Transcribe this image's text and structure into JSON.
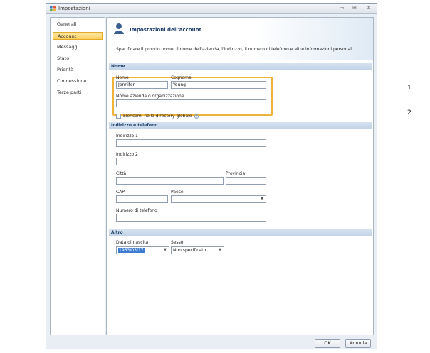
{
  "window": {
    "title": "Impostazioni",
    "controls": {
      "minimize": "▭",
      "maximize": "⊞",
      "close": "✕"
    }
  },
  "sidebar": {
    "items": [
      {
        "label": "Generali"
      },
      {
        "label": "Account"
      },
      {
        "label": "Messaggi"
      },
      {
        "label": "Stato"
      },
      {
        "label": "Priorità"
      },
      {
        "label": "Connessione"
      },
      {
        "label": "Terze parti"
      }
    ],
    "selected": "Account"
  },
  "header": {
    "title": "Impostazioni dell'account",
    "description": "Specificare il proprio nome, il nome dell'azienda, l'indirizzo, il numero di telefono e altre informazioni personali."
  },
  "sections": {
    "nome": {
      "title": "Nome",
      "first_name_label": "Nome",
      "first_name_value": "Jennifer",
      "last_name_label": "Cognome",
      "last_name_value": "Young",
      "company_label": "Nome azienda o organizzazione",
      "company_value": "",
      "directory_checkbox_label": "Elencami nella directory globale",
      "info_icon": "i"
    },
    "address": {
      "title": "Indirizzo e telefono",
      "address1_label": "Indirizzo 1",
      "address1_value": "",
      "address2_label": "Indirizzo 2",
      "address2_value": "",
      "city_label": "Città",
      "city_value": "",
      "province_label": "Provincia",
      "province_value": "",
      "cap_label": "CAP",
      "cap_value": "",
      "country_label": "Paese",
      "country_value": "",
      "phone_label": "Numero di telefono",
      "phone_value": ""
    },
    "altro": {
      "title": "Altro",
      "birth_label": "Data di nascita",
      "birth_value": "1963/03/17",
      "sex_label": "Sesso",
      "sex_value": "Non specificato"
    }
  },
  "footer": {
    "ok_label": "OK",
    "cancel_label": "Annulla"
  },
  "callouts": [
    "1",
    "2"
  ],
  "colors": {
    "accent_highlight": "#f0b33a",
    "section_bar": "#c9d9ec",
    "selected_sidebar": "#ffd46b",
    "selection_blue": "#3d7bd1"
  }
}
